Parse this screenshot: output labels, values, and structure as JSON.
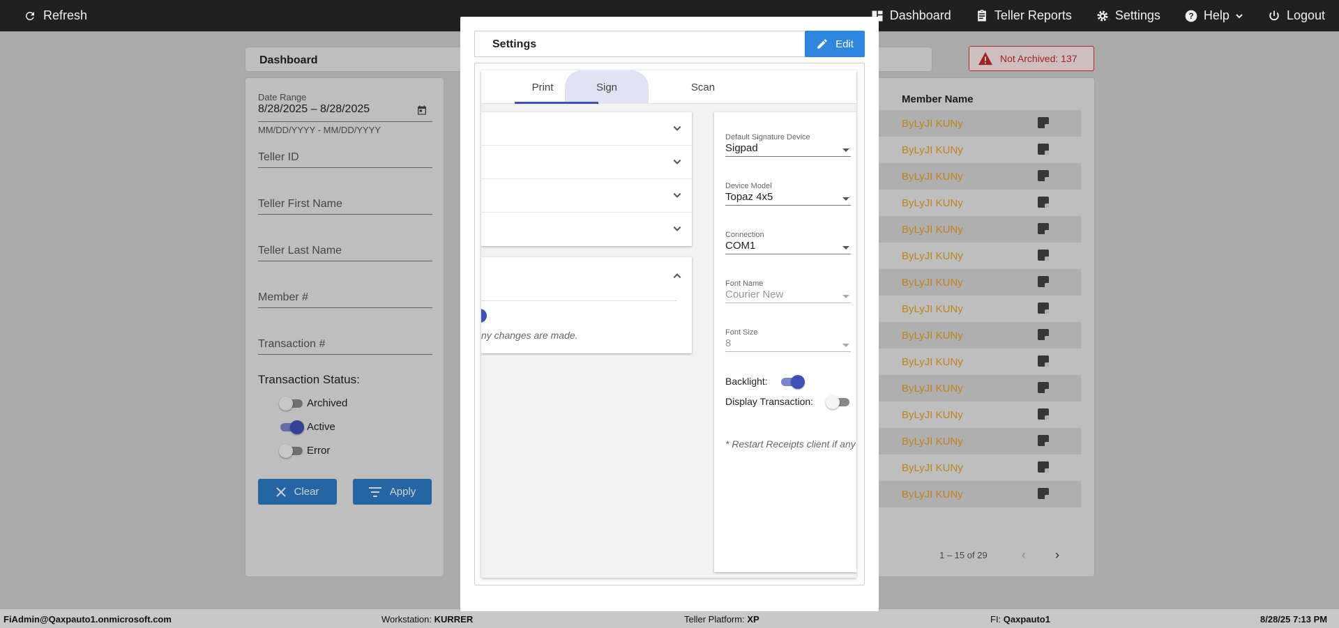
{
  "topbar": {
    "refresh_label": "Refresh",
    "nav": [
      {
        "label": "Dashboard",
        "icon": "dashboard-icon"
      },
      {
        "label": "Teller Reports",
        "icon": "clipboard-icon"
      },
      {
        "label": "Settings",
        "icon": "gear-icon"
      },
      {
        "label": "Help",
        "icon": "help-icon"
      },
      {
        "label": "Logout",
        "icon": "power-icon"
      }
    ]
  },
  "dashboard": {
    "title": "Dashboard",
    "not_archived": "Not Archived: 137"
  },
  "filters": {
    "date_range_label": "Date Range",
    "date_range_value": "8/28/2025 – 8/28/2025",
    "date_range_hint": "MM/DD/YYYY - MM/DD/YYYY",
    "teller_id": "Teller ID",
    "teller_first_name": "Teller First Name",
    "teller_last_name": "Teller Last Name",
    "member_number": "Member #",
    "transaction_number": "Transaction #",
    "status_title": "Transaction Status:",
    "statuses": [
      {
        "label": "Archived",
        "on": false
      },
      {
        "label": "Active",
        "on": true
      },
      {
        "label": "Error",
        "on": false
      }
    ],
    "clear_label": "Clear",
    "apply_label": "Apply"
  },
  "table": {
    "member_name_header": "Member Name",
    "rows": [
      "ByLyJI KUNy",
      "ByLyJI KUNy",
      "ByLyJI KUNy",
      "ByLyJI KUNy",
      "ByLyJI KUNy",
      "ByLyJI KUNy",
      "ByLyJI KUNy",
      "ByLyJI KUNy",
      "ByLyJI KUNy",
      "ByLyJI KUNy",
      "ByLyJI KUNy",
      "ByLyJI KUNy",
      "ByLyJI KUNy",
      "ByLyJI KUNy",
      "ByLyJI KUNy"
    ],
    "pager": "1 – 15 of 29"
  },
  "modal": {
    "title": "Settings",
    "edit_label": "Edit",
    "tabs": [
      "Print",
      "Sign",
      "Scan"
    ],
    "selected_tab": "Sign",
    "left_note": "ny changes are made.",
    "fields": [
      {
        "label": "Default Signature Device",
        "value": "Sigpad",
        "disabled": false
      },
      {
        "label": "Device Model",
        "value": "Topaz 4x5",
        "disabled": false
      },
      {
        "label": "Connection",
        "value": "COM1",
        "disabled": false
      },
      {
        "label": "Font Name",
        "value": "Courier New",
        "disabled": true
      },
      {
        "label": "Font Size",
        "value": "8",
        "disabled": true
      }
    ],
    "backlight_label": "Backlight:",
    "backlight_on": true,
    "display_transaction_label": "Display Transaction:",
    "display_transaction_on": false,
    "restart_note": "* Restart Receipts client if any"
  },
  "footer": {
    "user": "FiAdmin@Qaxpauto1.onmicrosoft.com",
    "workstation_label": "Workstation:",
    "workstation": "KURRER",
    "platform_label": "Teller Platform:",
    "platform": "XP",
    "fi_label": "FI:",
    "fi": "Qaxpauto1",
    "datetime": "8/28/25 7:13 PM"
  },
  "colors": {
    "topbar": "#202020",
    "accent_blue": "#2e7cc9",
    "toggle_on": "#3f51b5",
    "member_name": "#e8a020",
    "alert_red": "#c62828"
  }
}
